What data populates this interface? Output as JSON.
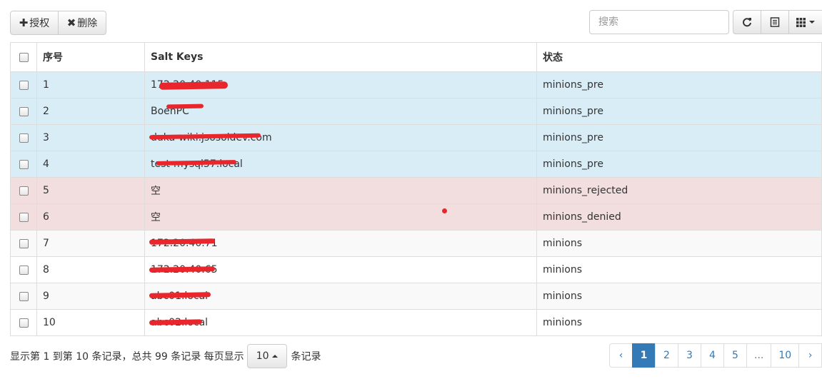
{
  "toolbar": {
    "auth_label": "授权",
    "delete_label": "删除",
    "search_placeholder": "搜索"
  },
  "table": {
    "headers": [
      "序号",
      "Salt Keys",
      "状态"
    ],
    "rows": [
      {
        "no": "1",
        "key": "172.20.40.115",
        "status": "minions_pre"
      },
      {
        "no": "2",
        "key": "BoenPC",
        "status": "minions_pre"
      },
      {
        "no": "3",
        "key": "duka-wiki.jsosoldev.com",
        "status": "minions_pre"
      },
      {
        "no": "4",
        "key": "test-mysql57.local",
        "status": "minions_pre"
      },
      {
        "no": "5",
        "key": "空",
        "status": "minions_rejected"
      },
      {
        "no": "6",
        "key": "空",
        "status": "minions_denied"
      },
      {
        "no": "7",
        "key": "172.20.40.71",
        "status": "minions"
      },
      {
        "no": "8",
        "key": "172.20.40.65",
        "status": "minions"
      },
      {
        "no": "9",
        "key": "abc01.local",
        "status": "minions"
      },
      {
        "no": "10",
        "key": "abc02.local",
        "status": "minions"
      }
    ]
  },
  "footer": {
    "prefix": "显示第 1 到第 10 条记录，总共 99 条记录 每页显示",
    "page_size": "10",
    "suffix": "条记录"
  },
  "pagination": {
    "prev": "‹",
    "pages": [
      "1",
      "2",
      "3",
      "4",
      "5",
      "...",
      "10"
    ],
    "next": "›",
    "active": "1"
  },
  "colors": {
    "info_row": "#d9edf7",
    "danger_row": "#f2dede",
    "accent": "#337ab7",
    "redaction": "#e8262b"
  }
}
